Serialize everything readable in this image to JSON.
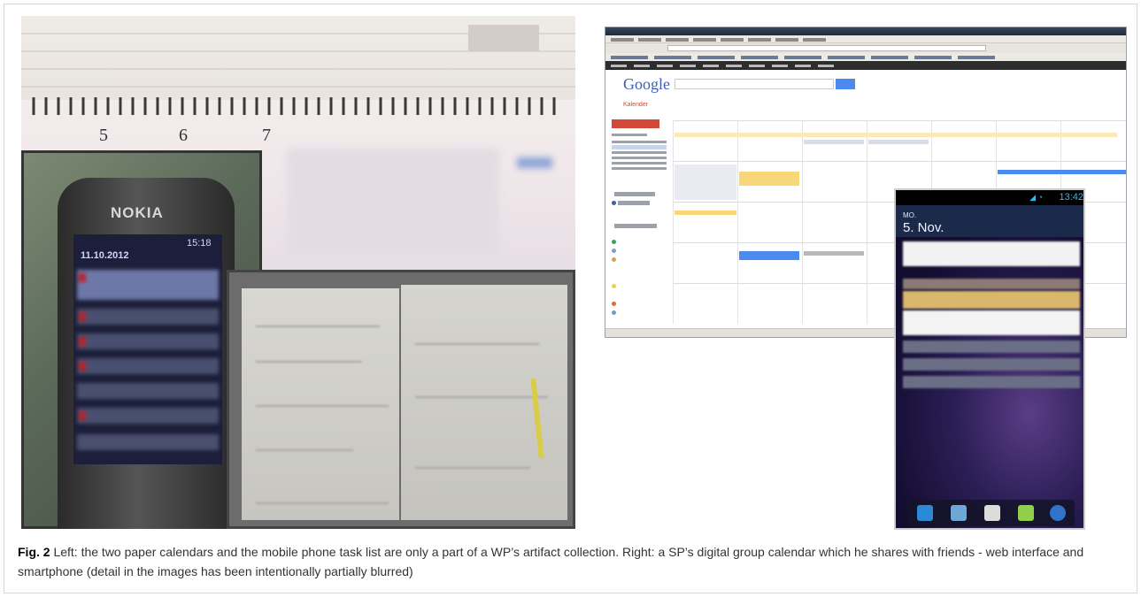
{
  "figure": {
    "label": "Fig. 2",
    "caption": "Left: the two paper calendars and the mobile phone task list are only a part of a WP’s artifact collection. Right: a SP’s digital group calendar which he shares with friends - web interface and smartphone (detail in the images has been intentionally partially blurred)"
  },
  "left_photo": {
    "planner_day_numbers": [
      "5",
      "6",
      "7"
    ],
    "phone_brand": "NOKIA",
    "phone_date": "11.10.2012",
    "phone_time": "15:18"
  },
  "web_calendar": {
    "logo": "Google",
    "section_title": "Kalender",
    "mini_calendar_title": "November 2012"
  },
  "smartphone": {
    "status_time": "13:42",
    "weekday": "MO.",
    "date": "5. Nov."
  },
  "colors": {
    "google_blue": "#3b5fb3",
    "create_red": "#d14836",
    "event_yellow": "#fbe3a0",
    "event_blue": "#4d8af0",
    "android_accent": "#2fb8ff"
  }
}
